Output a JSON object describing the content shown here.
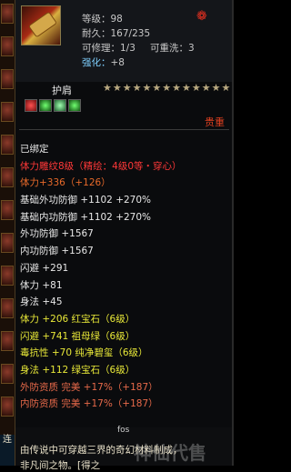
{
  "item": {
    "level_text": "等级：98",
    "durability_text": "耐久：167/235",
    "repair_text": "可修理：1/3",
    "rewash_text": "可重洗：3",
    "strengthen_label": "强化：",
    "strengthen_value": "+8",
    "slot_name": "护肩",
    "rarity": "贵重"
  },
  "stars": [
    "★",
    "★",
    "★",
    "★",
    "★",
    "★",
    "★",
    "★",
    "★",
    "★",
    "★",
    "★",
    "★"
  ],
  "gem_slots": [
    {
      "color": "#c8202a"
    },
    {
      "color": "#2aa84a"
    },
    {
      "color": "#2aa84a"
    },
    {
      "color": "#2aa84a"
    }
  ],
  "lines": [
    {
      "text": "已绑定",
      "color": "white"
    },
    {
      "text": "体力雕纹8级（精绘：4级0等・穿心）",
      "color": "red"
    },
    {
      "text": "体力+336（+126）",
      "color": "orange"
    },
    {
      "text": "基础外功防御 +1102 +270%",
      "color": "white"
    },
    {
      "text": "基础内功防御 +1102 +270%",
      "color": "white"
    },
    {
      "text": "外功防御 +1567",
      "color": "white"
    },
    {
      "text": "内功防御 +1567",
      "color": "white"
    },
    {
      "text": "闪避 +291",
      "color": "white"
    },
    {
      "text": "体力 +81",
      "color": "white"
    },
    {
      "text": "身法 +45",
      "color": "white"
    },
    {
      "text": "体力 +206 红宝石（6级）",
      "color": "yellow"
    },
    {
      "text": "闪避 +741 祖母绿（6级）",
      "color": "yellow"
    },
    {
      "text": "毒抗性 +70 纯净碧玺（6级）",
      "color": "yellow"
    },
    {
      "text": "身法 +112 绿宝石（6级）",
      "color": "yellow"
    },
    {
      "text": "外防资质  完美 +17%（+187）",
      "color": "salmon"
    },
    {
      "text": "内防资质  完美 +17%（+187）",
      "color": "salmon"
    }
  ],
  "footer": {
    "label": "fos",
    "description": "由传说中可穿越三界的奇幻材料制成，",
    "description2": "非凡间之物。[得之",
    "watermark": "神仙代售",
    "left_text": "连"
  }
}
